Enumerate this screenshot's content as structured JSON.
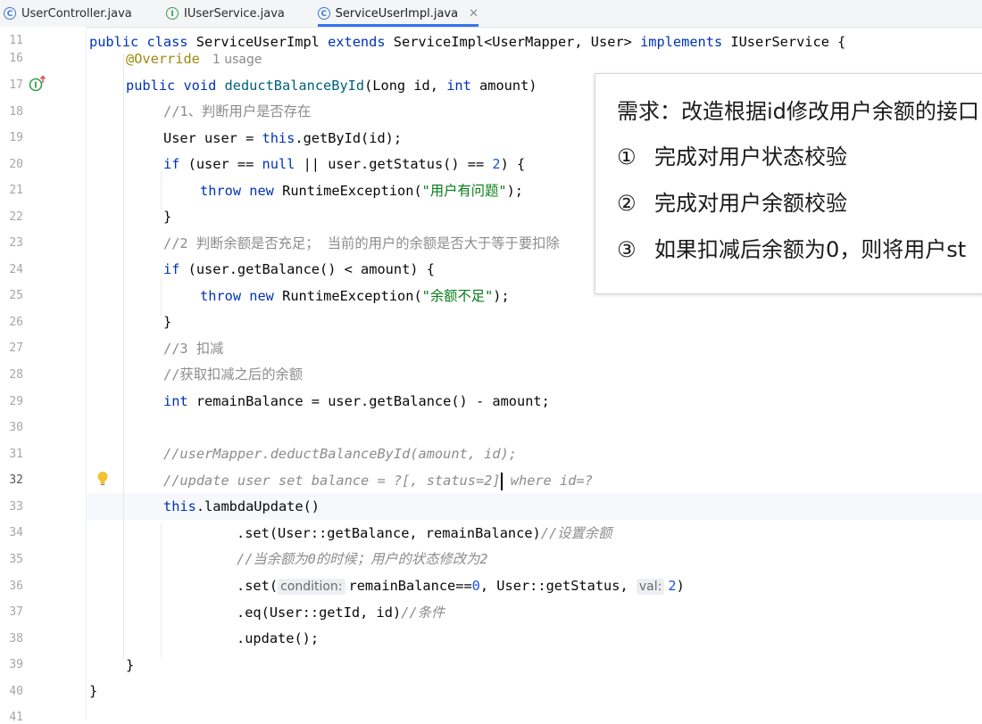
{
  "tabs": [
    {
      "label": "UserController.java",
      "icon": "class-icon"
    },
    {
      "label": "IUserService.java",
      "icon": "interface-icon"
    },
    {
      "label": "ServiceUserImpl.java",
      "icon": "class-icon",
      "active": true
    }
  ],
  "gutter": {
    "line_numbers": [
      "11",
      "16",
      "17",
      "18",
      "19",
      "20",
      "21",
      "22",
      "23",
      "24",
      "25",
      "26",
      "27",
      "28",
      "29",
      "30",
      "31",
      "32",
      "33",
      "34",
      "35",
      "36",
      "37",
      "38",
      "39",
      "40",
      "41"
    ],
    "current_line": "32"
  },
  "code": {
    "l11": {
      "a": "public ",
      "b": "class ",
      "c": "ServiceUserImpl ",
      "d": "extends ",
      "e": "ServiceImpl<UserMapper, User> ",
      "f": "implements ",
      "g": "IUserService {"
    },
    "l16": {
      "a": "@Override",
      "usage": "1 usage"
    },
    "l17": {
      "a": "public ",
      "b": "void ",
      "c": "deductBalanceById",
      "d": "(Long id, ",
      "e": "int ",
      "f": "amount)"
    },
    "l18": {
      "a": "//1、判断用户是否存在"
    },
    "l19": {
      "a": "User user = ",
      "b": "this",
      "c": ".getById(id);"
    },
    "l20": {
      "a": "if ",
      "b": "(user == ",
      "c": "null ",
      "d": "|| user.getStatus() == ",
      "e": "2",
      "f": ") {"
    },
    "l21": {
      "a": "throw ",
      "b": "new ",
      "c": "RuntimeException(",
      "d": "\"用户有问题\"",
      "e": ");"
    },
    "l22": {
      "a": "}"
    },
    "l23": {
      "a": "//2 判断余额是否充足； 当前的用户的余额是否大于等于要扣除"
    },
    "l24": {
      "a": "if ",
      "b": "(user.getBalance() < amount) {"
    },
    "l25": {
      "a": "throw ",
      "b": "new ",
      "c": "RuntimeException(",
      "d": "\"余额不足\"",
      "e": ");"
    },
    "l26": {
      "a": "}"
    },
    "l27": {
      "a": "//3 扣减"
    },
    "l28": {
      "a": "//获取扣减之后的余额"
    },
    "l29": {
      "a": "int ",
      "b": "remainBalance = user.getBalance() - amount;"
    },
    "l31": {
      "a": "//userMapper.deductBalanceById(amount, id);"
    },
    "l32": {
      "a": "//update user set balance = ?[, status=2]",
      "b": " where id=?"
    },
    "l33": {
      "a": "this",
      "b": ".lambdaUpdate()"
    },
    "l34": {
      "a": ".set(User::getBalance, remainBalance)",
      "b": "//设置余额"
    },
    "l35": {
      "a": "//当余额为0的时候；用户的状态修改为2"
    },
    "l36": {
      "a": ".set(",
      "hint1": "condition:",
      "b": "remainBalance==",
      "c": "0",
      "d": ", User::getStatus, ",
      "hint2": "val:",
      "e": "2",
      "f": ")"
    },
    "l37": {
      "a": ".eq(User::getId, id)",
      "b": "//条件"
    },
    "l38": {
      "a": ".update();"
    },
    "l39": {
      "a": "}"
    },
    "l40": {
      "a": "}"
    }
  },
  "overlay": {
    "title": "需求：改造根据id修改用户余额的接口",
    "items": [
      {
        "mark": "①",
        "text": "完成对用户状态校验"
      },
      {
        "mark": "②",
        "text": "完成对用户余额校验"
      },
      {
        "mark": "③",
        "text": "如果扣减后余额为0，则将用户st"
      }
    ]
  },
  "colors": {
    "keyword": "#0033b3",
    "method": "#00627a",
    "string": "#067d17",
    "number": "#1750eb",
    "comment": "#8c8c8c",
    "annotation": "#9e880d",
    "tab_underline": "#3574f0"
  },
  "icons": {
    "implements_marker": "implements-method-icon",
    "bulb": "intention-bulb-icon",
    "close": "close-icon"
  }
}
